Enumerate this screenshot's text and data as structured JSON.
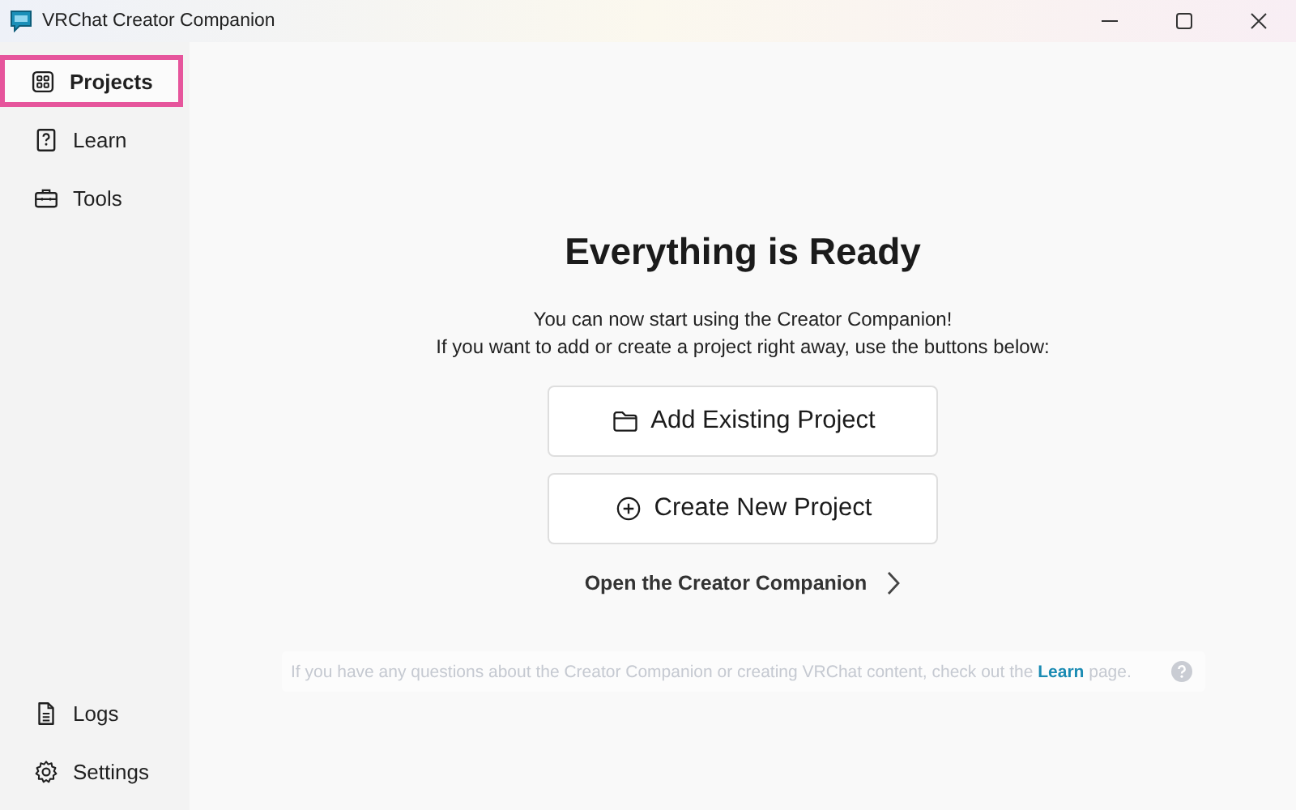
{
  "window": {
    "title": "VRChat Creator Companion",
    "controls": [
      {
        "kind": "minimize"
      },
      {
        "kind": "maximize"
      },
      {
        "kind": "close"
      }
    ]
  },
  "sidebar": {
    "top_items": [
      {
        "label": "Projects",
        "selected": true,
        "highlighted": true
      },
      {
        "label": "Learn",
        "selected": false,
        "highlighted": false
      },
      {
        "label": "Tools",
        "selected": false,
        "highlighted": false
      }
    ],
    "bottom_items": [
      {
        "label": "Logs",
        "selected": false,
        "highlighted": false
      },
      {
        "label": "Settings",
        "selected": false,
        "highlighted": false
      }
    ]
  },
  "main": {
    "heading": "Everything is Ready",
    "subtitle_lines": [
      "You can now start using the Creator Companion!",
      "If you want to add or create a project right away, use the buttons below:"
    ],
    "buttons": [
      {
        "label": "Add Existing Project"
      },
      {
        "label": "Create New Project"
      }
    ],
    "link": "Open the Creator Companion",
    "info": {
      "before": "If you have any questions about the Creator Companion or creating VRChat content, check out the ",
      "link": "Learn",
      "after": " page."
    }
  }
}
